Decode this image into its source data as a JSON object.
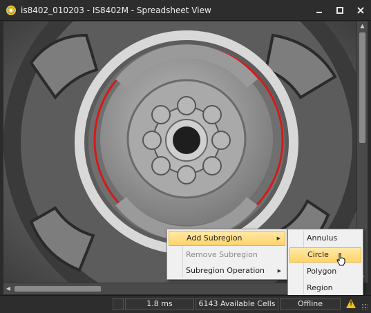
{
  "window": {
    "title": "is8402_010203 - IS8402M - Spreadsheet View",
    "app_icon": "insight-app-icon",
    "buttons": {
      "minimize": "minimize-icon",
      "maximize": "maximize-icon",
      "close": "close-icon"
    }
  },
  "viewport": {
    "image_subject": "grayscale gear pump image with red circle region",
    "region_color": "#d41a1a"
  },
  "context_menu": {
    "items": [
      {
        "label": "Add Subregion",
        "has_submenu": true,
        "highlighted": true,
        "enabled": true
      },
      {
        "label": "Remove Subregion",
        "has_submenu": false,
        "highlighted": false,
        "enabled": false
      },
      {
        "label": "Subregion Operation",
        "has_submenu": true,
        "highlighted": false,
        "enabled": true
      }
    ]
  },
  "submenu": {
    "items": [
      {
        "label": "Annulus",
        "highlighted": false
      },
      {
        "label": "Circle",
        "highlighted": true
      },
      {
        "label": "Polygon",
        "highlighted": false
      },
      {
        "label": "Region",
        "highlighted": false
      }
    ]
  },
  "status_bar": {
    "timing": "1.8 ms",
    "cells": "6143 Available Cells",
    "mode": "Offline",
    "warning_icon": "warning-icon"
  },
  "colors": {
    "menu_highlight": "#ffd36a",
    "warning": "#f2c218",
    "chrome": "#2d2d2d"
  }
}
